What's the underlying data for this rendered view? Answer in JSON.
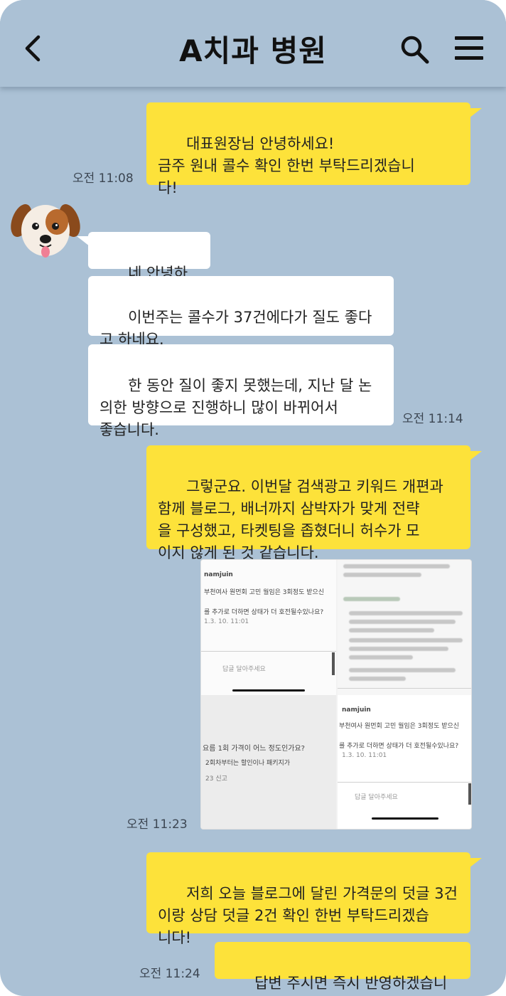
{
  "header": {
    "title": "A치과 병원",
    "back_icon": "chevron-left-icon",
    "search_icon": "search-icon",
    "menu_icon": "hamburger-menu-icon"
  },
  "colors": {
    "background": "#abc1d5",
    "my_bubble": "#fde23a",
    "their_bubble": "#ffffff"
  },
  "messages": [
    {
      "from": "me",
      "text": "대표원장님 안녕하세요!\n금주 원내 콜수 확인 한번 부탁드리겠습니\n다!",
      "time": "오전 11:08"
    },
    {
      "from": "them",
      "text": "네 안녕하세요."
    },
    {
      "from": "them",
      "text": "이번주는 콜수가 37건에다가 질도 좋다\n고 하네요."
    },
    {
      "from": "them",
      "text": "한 동안 질이 좋지 못했는데, 지난 달 논\n의한 방향으로 진행하니 많이 바뀌어서\n좋습니다.",
      "time": "오전 11:14"
    },
    {
      "from": "me",
      "text": "그렇군요. 이번달 검색광고 키워드 개편과\n함께 블로그, 배너까지 삼박자가 맞게 전략\n을 구성했고, 타켓팅을 좁혔더니 허수가 모\n이지 않게 된 것 같습니다."
    },
    {
      "from": "me",
      "type": "image",
      "time": "오전 11:23",
      "image_text": {
        "user_a": "namjuin",
        "line_a": "부천여사 원먼회 고민 월임은 3회정도 받으신",
        "line_b": "를 추가로 더하면 상태가 더 호전될수있나요?",
        "date_a": "1.3. 10. 11:01",
        "reply_a": "답글 달아주세요",
        "question": "요름 1회 가격이 어느 정도인가요?",
        "question2": "2회차부터는 할인이나 패키지가",
        "meta": "23   신고",
        "user_b": "namjuin",
        "line_c": "부천여사 원먼회 고민 월임은 3회정도 받으신",
        "line_d": "를 추가로 더하면 상태가 더 호전될수있나요?",
        "date_b": "1.3. 10. 11:01",
        "reply_b": "답글 달아주세요"
      }
    },
    {
      "from": "me",
      "text": "저희 오늘 블로그에 달린 가격문의 덧글 3건\n이랑 상담 덧글 2건 확인 한번 부탁드리겠습\n니다!"
    },
    {
      "from": "me",
      "text": "답변 주시면 즉시 반영하겠습니다.",
      "time": "오전 11:24"
    }
  ],
  "avatar_icon": "puppy-face-icon"
}
